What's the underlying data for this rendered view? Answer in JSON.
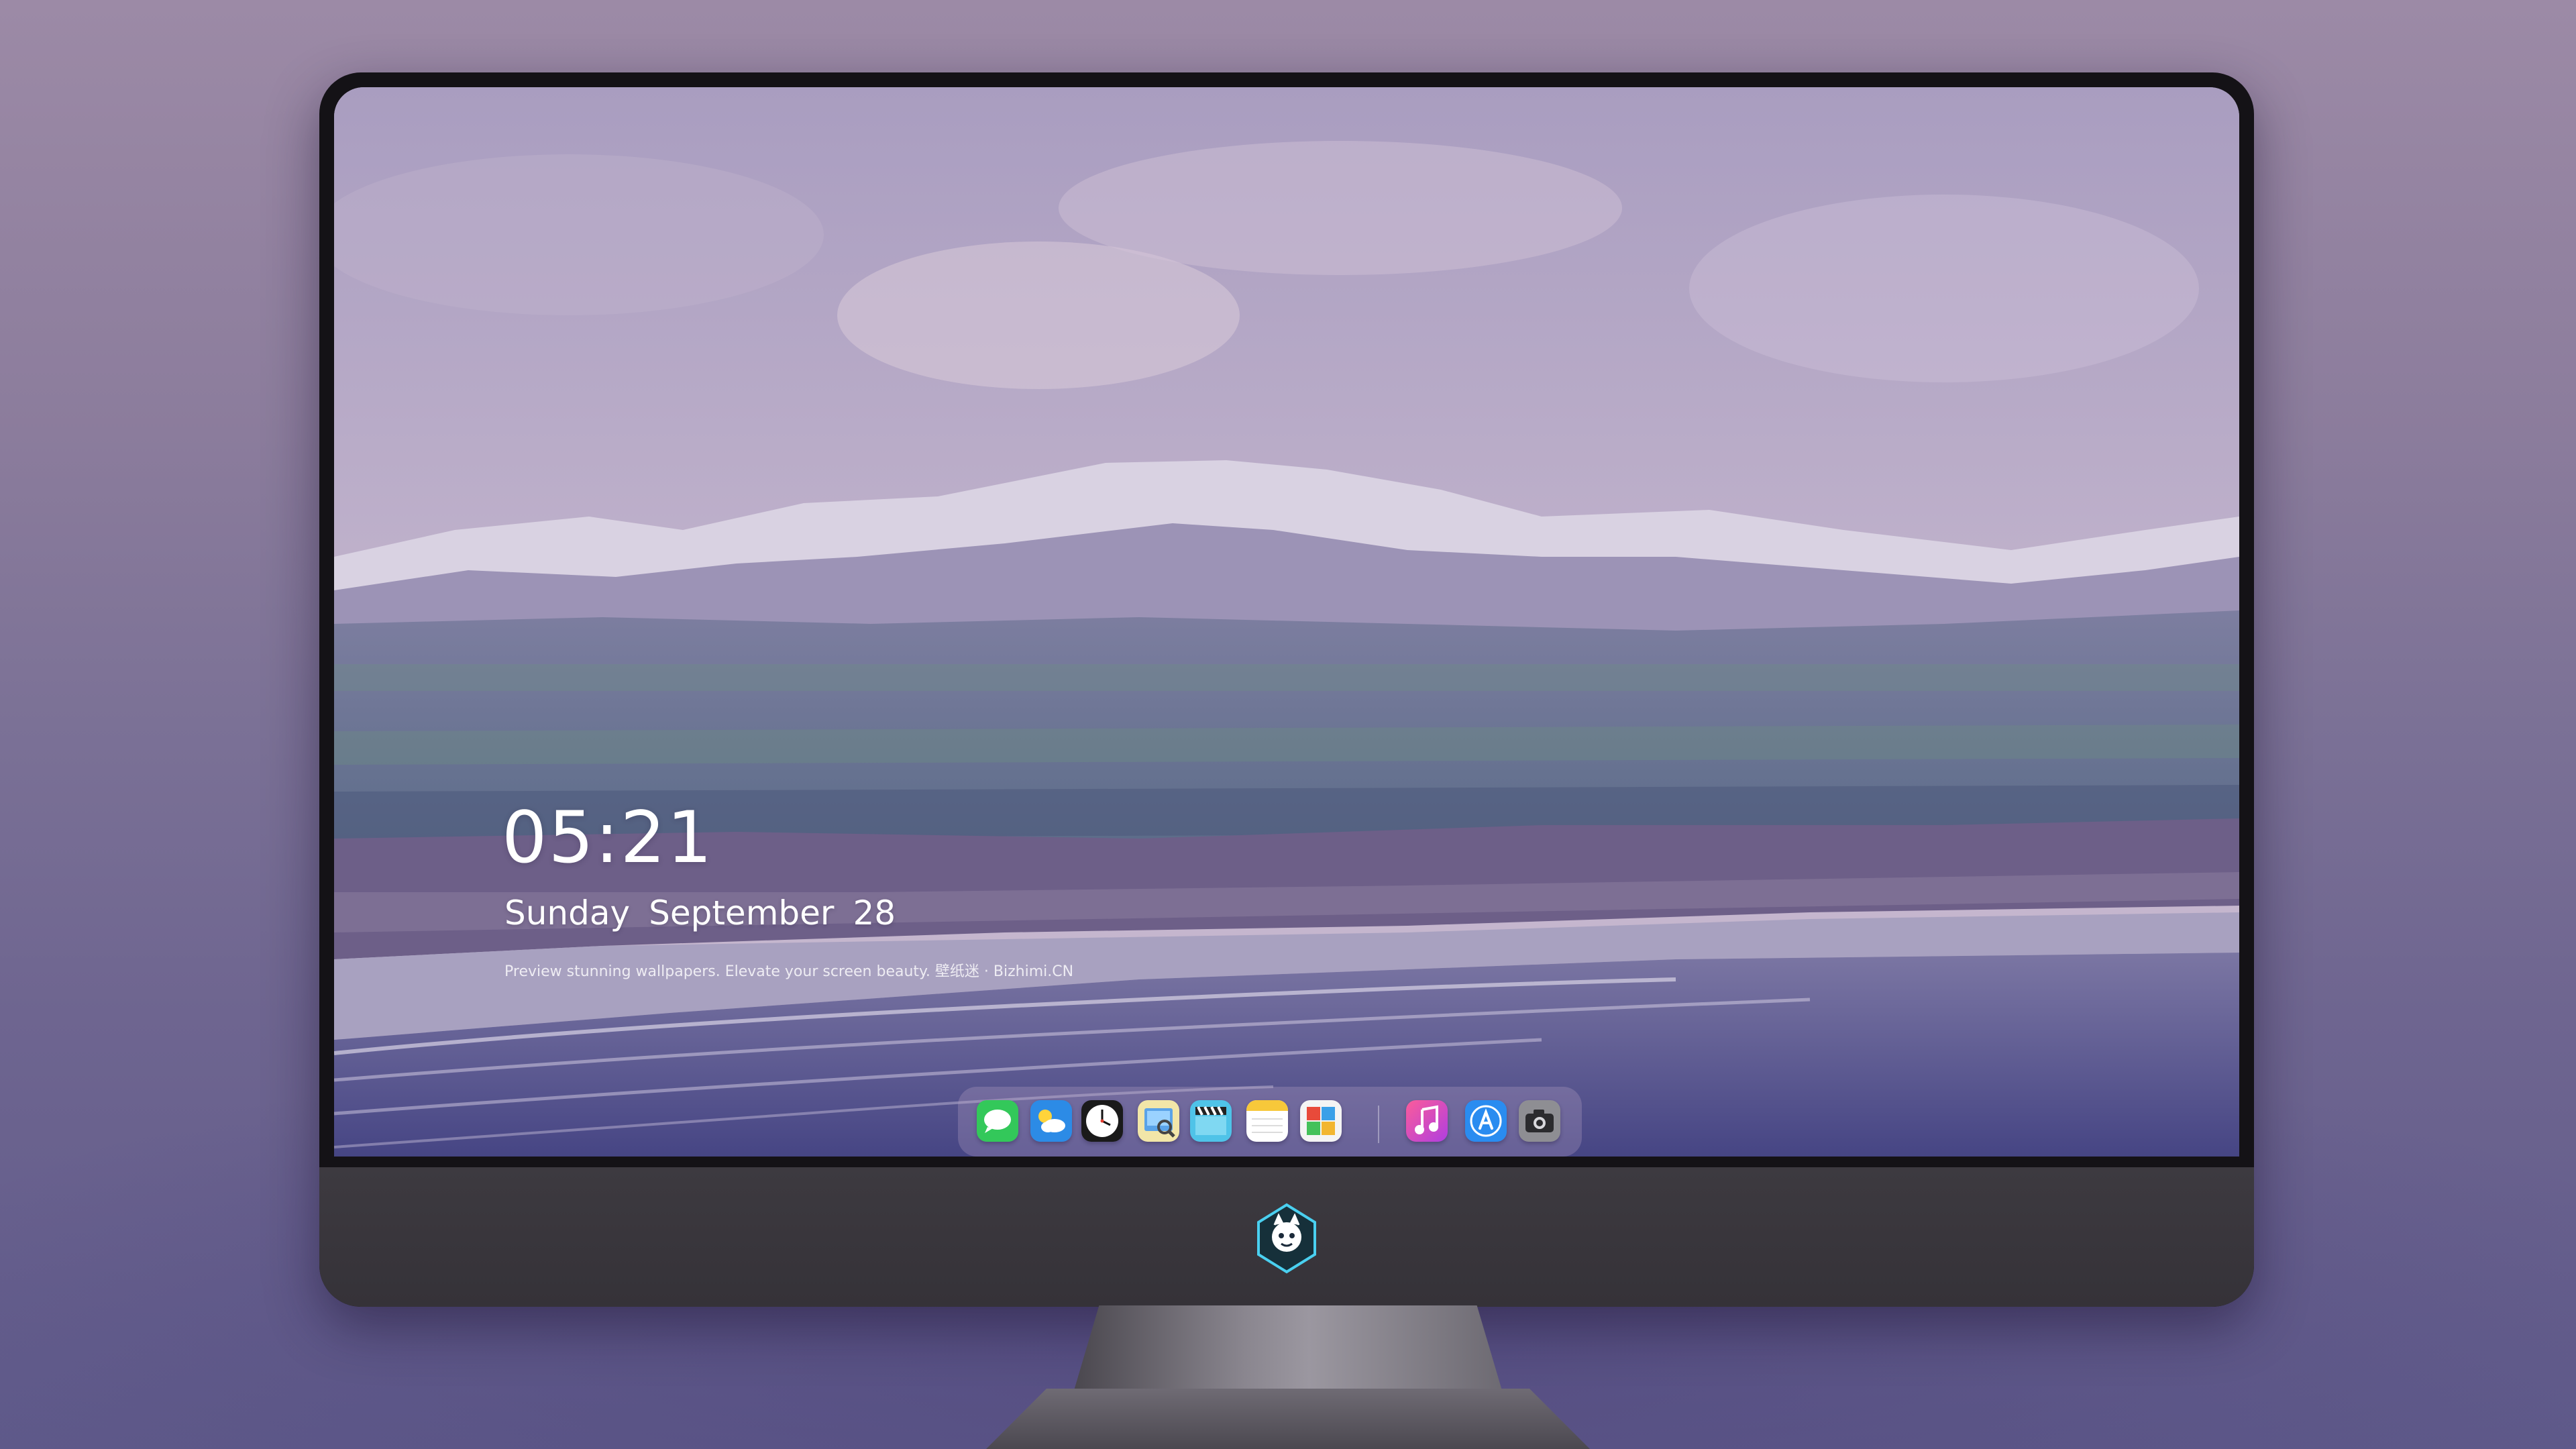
{
  "lock_screen": {
    "time": "05:21",
    "weekday": "Sunday",
    "month": "September",
    "day": "28",
    "caption": "Preview stunning wallpapers. Elevate your screen beauty. 壁纸迷 · Bizhimi.CN"
  },
  "dock": {
    "apps": [
      {
        "name": "messages-icon"
      },
      {
        "name": "weather-icon"
      },
      {
        "name": "clock-icon"
      },
      {
        "name": "preview-icon"
      },
      {
        "name": "clips-icon"
      },
      {
        "name": "notes-icon"
      },
      {
        "name": "photo-booth-icon"
      },
      {
        "name": "music-icon"
      },
      {
        "name": "app-store-icon"
      },
      {
        "name": "camera-icon"
      }
    ]
  },
  "colors": {
    "backdrop": "#8b7c9c",
    "monitor_bezel": "#141216",
    "chin": "#3d3a40",
    "text": "#ffffff"
  }
}
